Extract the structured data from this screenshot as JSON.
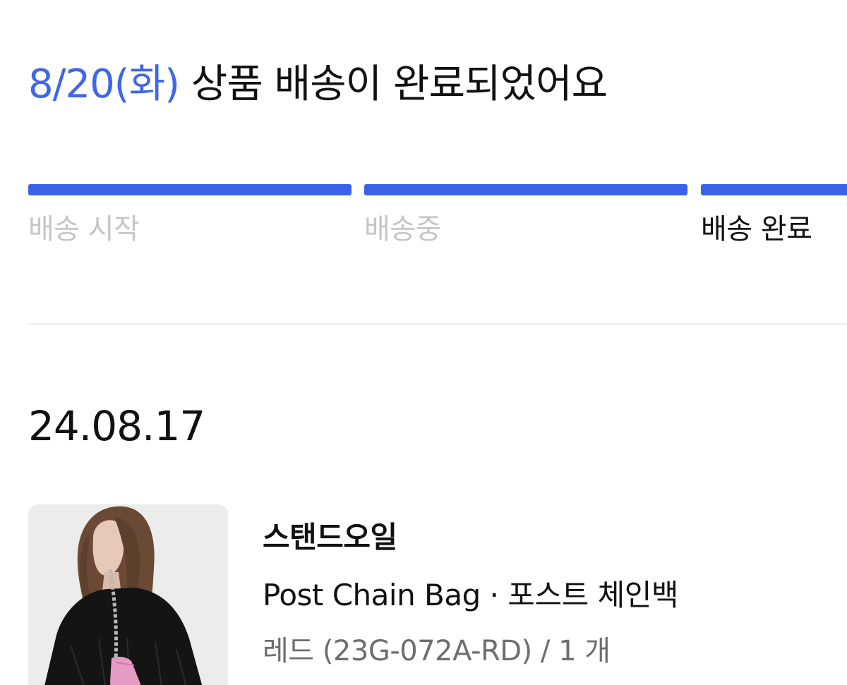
{
  "status": {
    "date": "8/20(화)",
    "message": "상품 배송이 완료되었어요"
  },
  "progress": {
    "steps": [
      {
        "label": "배송 시작",
        "complete": true,
        "current": false
      },
      {
        "label": "배송중",
        "complete": true,
        "current": false
      },
      {
        "label": "배송 완료",
        "complete": true,
        "current": true
      }
    ],
    "accent_color": "#3A62E8"
  },
  "order": {
    "date": "24.08.17",
    "item": {
      "brand": "스탠드오일",
      "name": "Post Chain Bag · 포스트 체인백",
      "option": "레드 (23G-072A-RD) / 1 개"
    }
  }
}
